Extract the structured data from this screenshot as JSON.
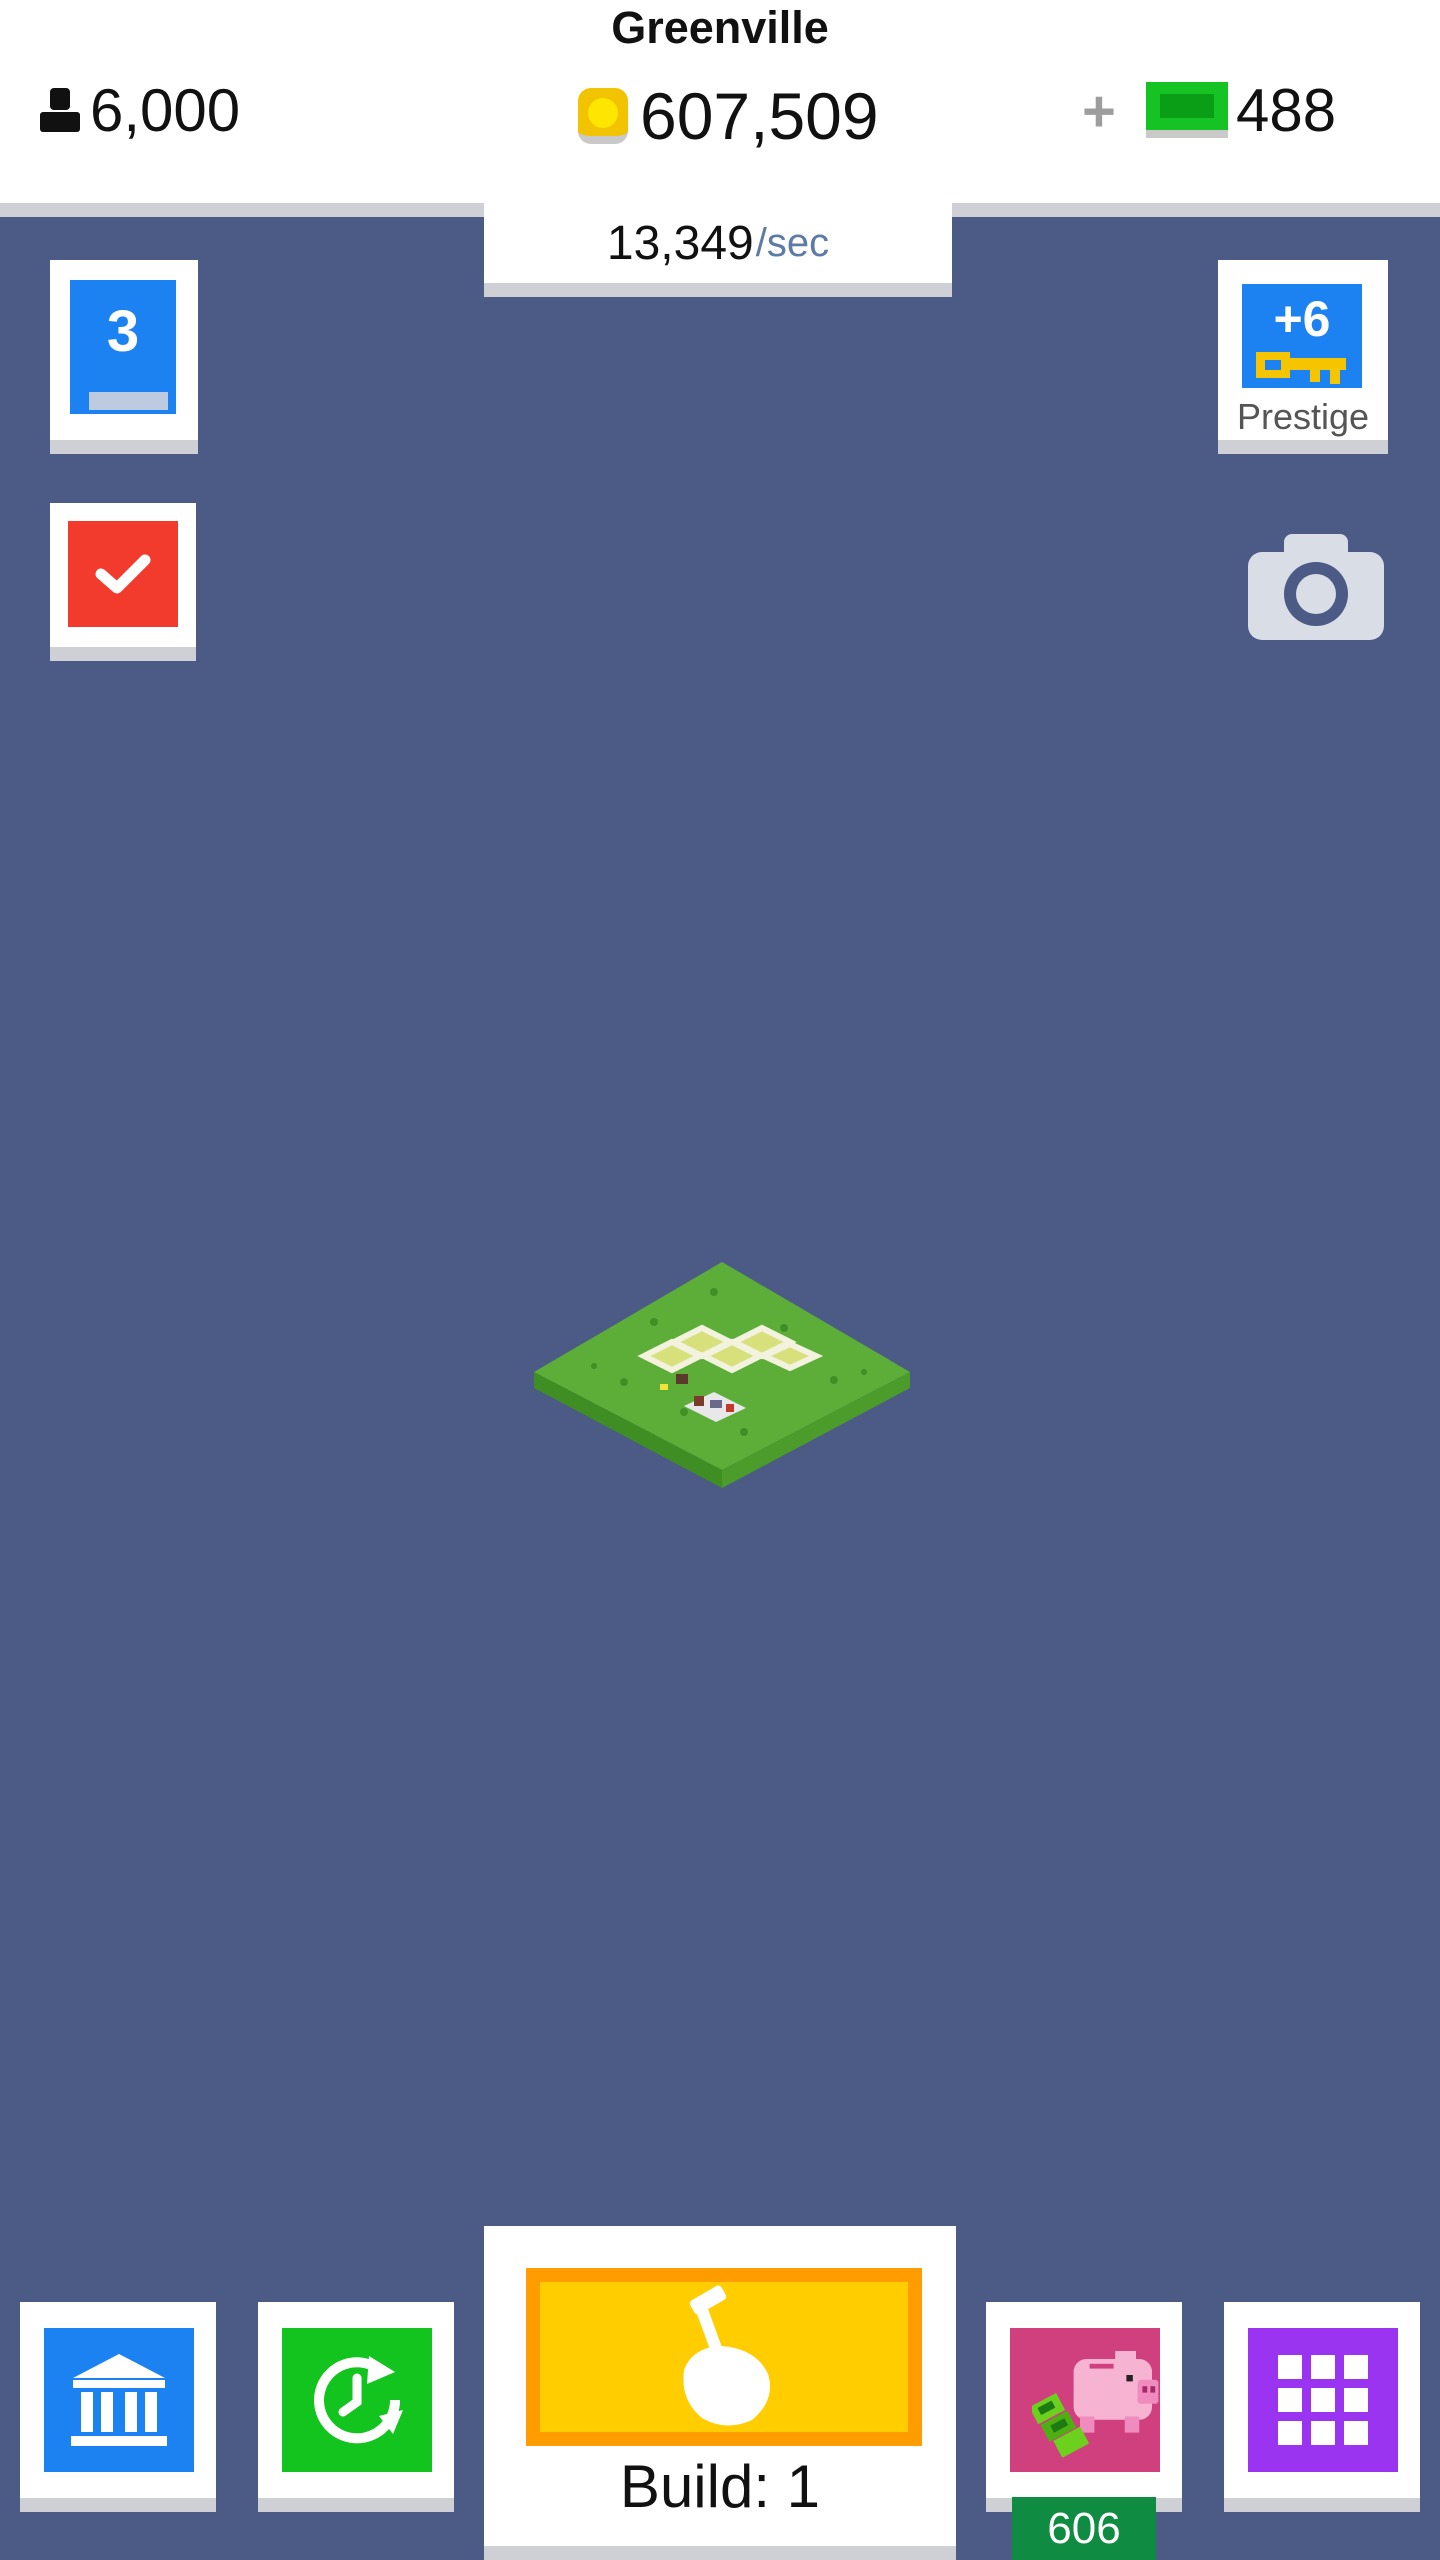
{
  "header": {
    "city_name": "Greenville",
    "population": "6,000",
    "population_icon": "person-icon",
    "coins": "607,509",
    "coin_icon": "coin-icon",
    "add_label": "+",
    "cash": "488",
    "cash_icon": "cash-icon",
    "rate_value": "13,349",
    "rate_unit": "/sec"
  },
  "left_panel": {
    "level": "3",
    "level_progress": 0.12,
    "tasks_icon": "checkmark-icon"
  },
  "right_panel": {
    "prestige_value": "+6",
    "prestige_icon": "key-icon",
    "prestige_label": "Prestige",
    "camera_icon": "camera-icon"
  },
  "bottom_bar": {
    "bank_icon": "bank-icon",
    "time_icon": "clock-refresh-icon",
    "build_icon": "hammer-hand-icon",
    "build_label": "Build: 1",
    "piggy_icon": "piggy-bank-icon",
    "piggy_count": "606",
    "menu_icon": "grid-menu-icon"
  },
  "colors": {
    "background": "#4b5b85",
    "blue": "#1c82f2",
    "red": "#f23b2c",
    "green": "#13c41f",
    "yellow": "#ffcd00",
    "orange": "#ff9d00",
    "purple": "#9b34f0",
    "pink": "#d0407e",
    "dark_green": "#0f8c42"
  }
}
